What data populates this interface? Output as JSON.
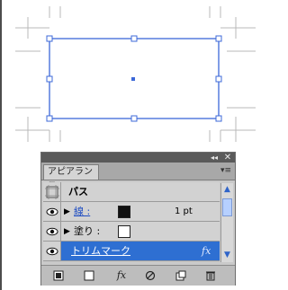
{
  "canvas": {
    "selection_color": "#3c68d8",
    "guide_color": "#b9b9b9"
  },
  "panel": {
    "tab_label": "アピアランス",
    "title_controls": {
      "collapse_icon": "double-chevron-right-icon",
      "close_icon": "close-icon",
      "menu_icon": "panel-menu-icon"
    },
    "rows": [
      {
        "type": "object",
        "label": "パス"
      },
      {
        "type": "stroke",
        "label": "線 :",
        "swatch": "#111111",
        "value": "1 pt"
      },
      {
        "type": "fill",
        "label": "塗り :",
        "swatch": "#ffffff"
      },
      {
        "type": "effect",
        "label": "トリムマーク",
        "effect_icon": "fx-icon",
        "selected": true
      }
    ],
    "bottom_buttons": [
      "add-new-stroke-icon",
      "add-new-fill-icon",
      "add-new-effect-icon",
      "clear-appearance-icon",
      "duplicate-item-icon",
      "delete-item-icon"
    ]
  }
}
